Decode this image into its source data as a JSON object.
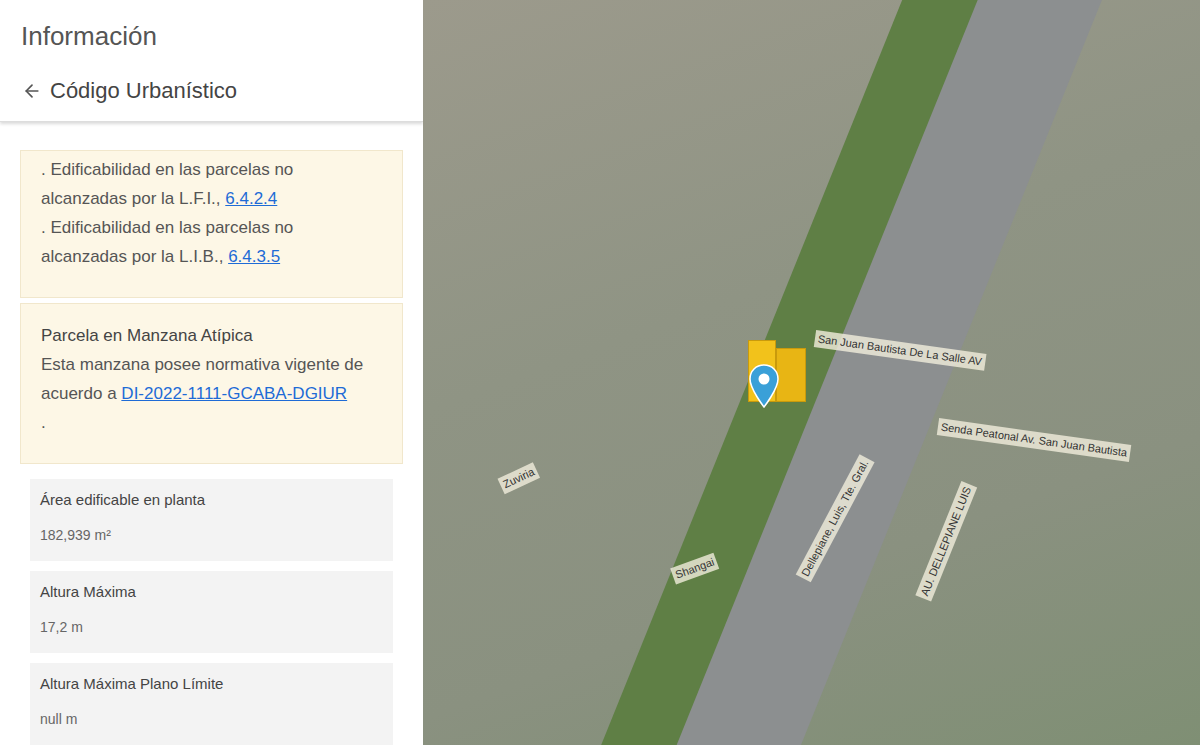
{
  "panel": {
    "title": "Información",
    "subtitle": "Código Urbanístico"
  },
  "notes": [
    {
      "text": ". Edificabilidad en las parcelas no alcanzadas por la L.F.I.,",
      "link": "6.4.2.4"
    },
    {
      "text": ". Edificabilidad en las parcelas no alcanzadas por la L.I.B.,",
      "link": "6.4.3.5"
    }
  ],
  "atypical": {
    "title": "Parcela en Manzana Atípica",
    "text": "Esta manzana posee normativa vigente de acuerdo a",
    "link": "DI-2022-1111-GCABA-DGIUR",
    "suffix": "."
  },
  "fields": [
    {
      "label": "Área edificable en planta",
      "value": "182,939 m²"
    },
    {
      "label": "Altura Máxima",
      "value": "17,2 m"
    },
    {
      "label": "Altura Máxima Plano Límite",
      "value": "null m"
    }
  ],
  "map": {
    "labels": [
      "San Juan Bautista De La Salle AV",
      "Senda Peatonal Av. San Juan Bautista",
      "Zuviria",
      "Shangai",
      "Dellepiane, Luis, Tte. Gral.",
      "AU. DELLEPIANE LUIS"
    ]
  }
}
